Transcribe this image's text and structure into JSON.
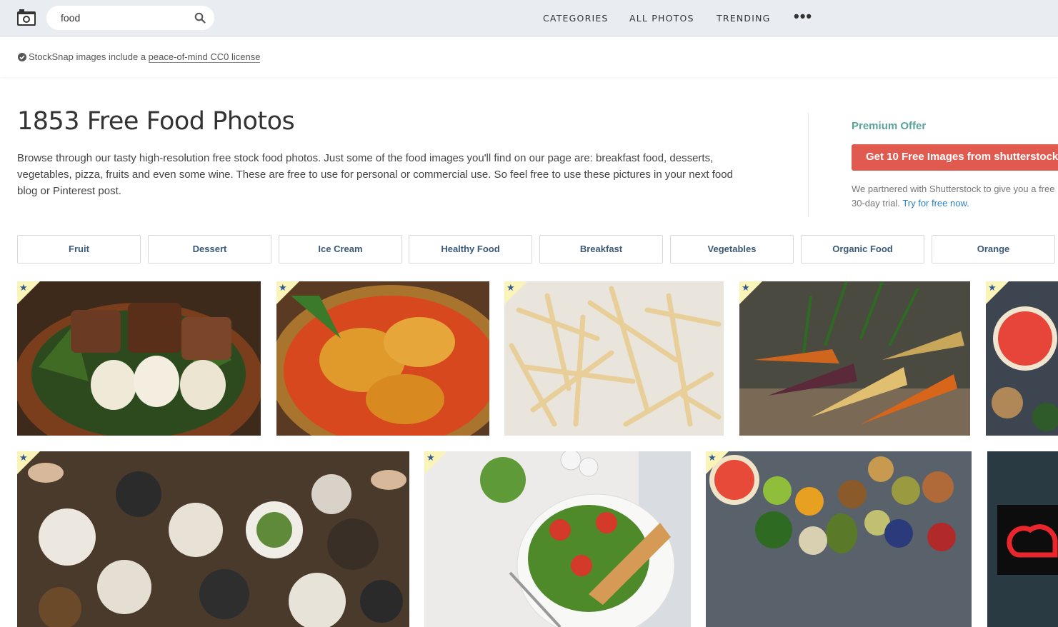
{
  "nav": {
    "search_value": "food",
    "links": [
      "CATEGORIES",
      "ALL PHOTOS",
      "TRENDING"
    ],
    "more": "•••"
  },
  "license": {
    "prefix": "StockSnap images include a ",
    "link": "peace-of-mind CC0 license"
  },
  "heading": {
    "title": "1853 Free Food Photos",
    "description": "Browse through our tasty high-resolution free stock food photos. Just some of the food images you'll find on our page are: breakfast food, desserts, vegetables, pizza, fruits and even some wine. These are free to use for personal or commercial use. So feel free to use these pictures in your next food blog or Pinterest post."
  },
  "offer": {
    "title": "Premium Offer",
    "button": "Get 10 Free Images from shutterstock",
    "text": "We partnered with Shutterstock to give you a free 30-day trial.",
    "link": "Try for free now."
  },
  "tags": [
    "Fruit",
    "Dessert",
    "Ice Cream",
    "Healthy Food",
    "Breakfast",
    "Vegetables",
    "Organic Food",
    "Orange"
  ],
  "photos": {
    "star": "★"
  },
  "colors": {
    "topbar": "#e9edf1",
    "offer_title": "#5aa39b",
    "offer_button": "#e15a50",
    "tag_text": "#3b5a7a",
    "premium_flag": "#fbf4b8",
    "star": "#2f5a9a"
  }
}
